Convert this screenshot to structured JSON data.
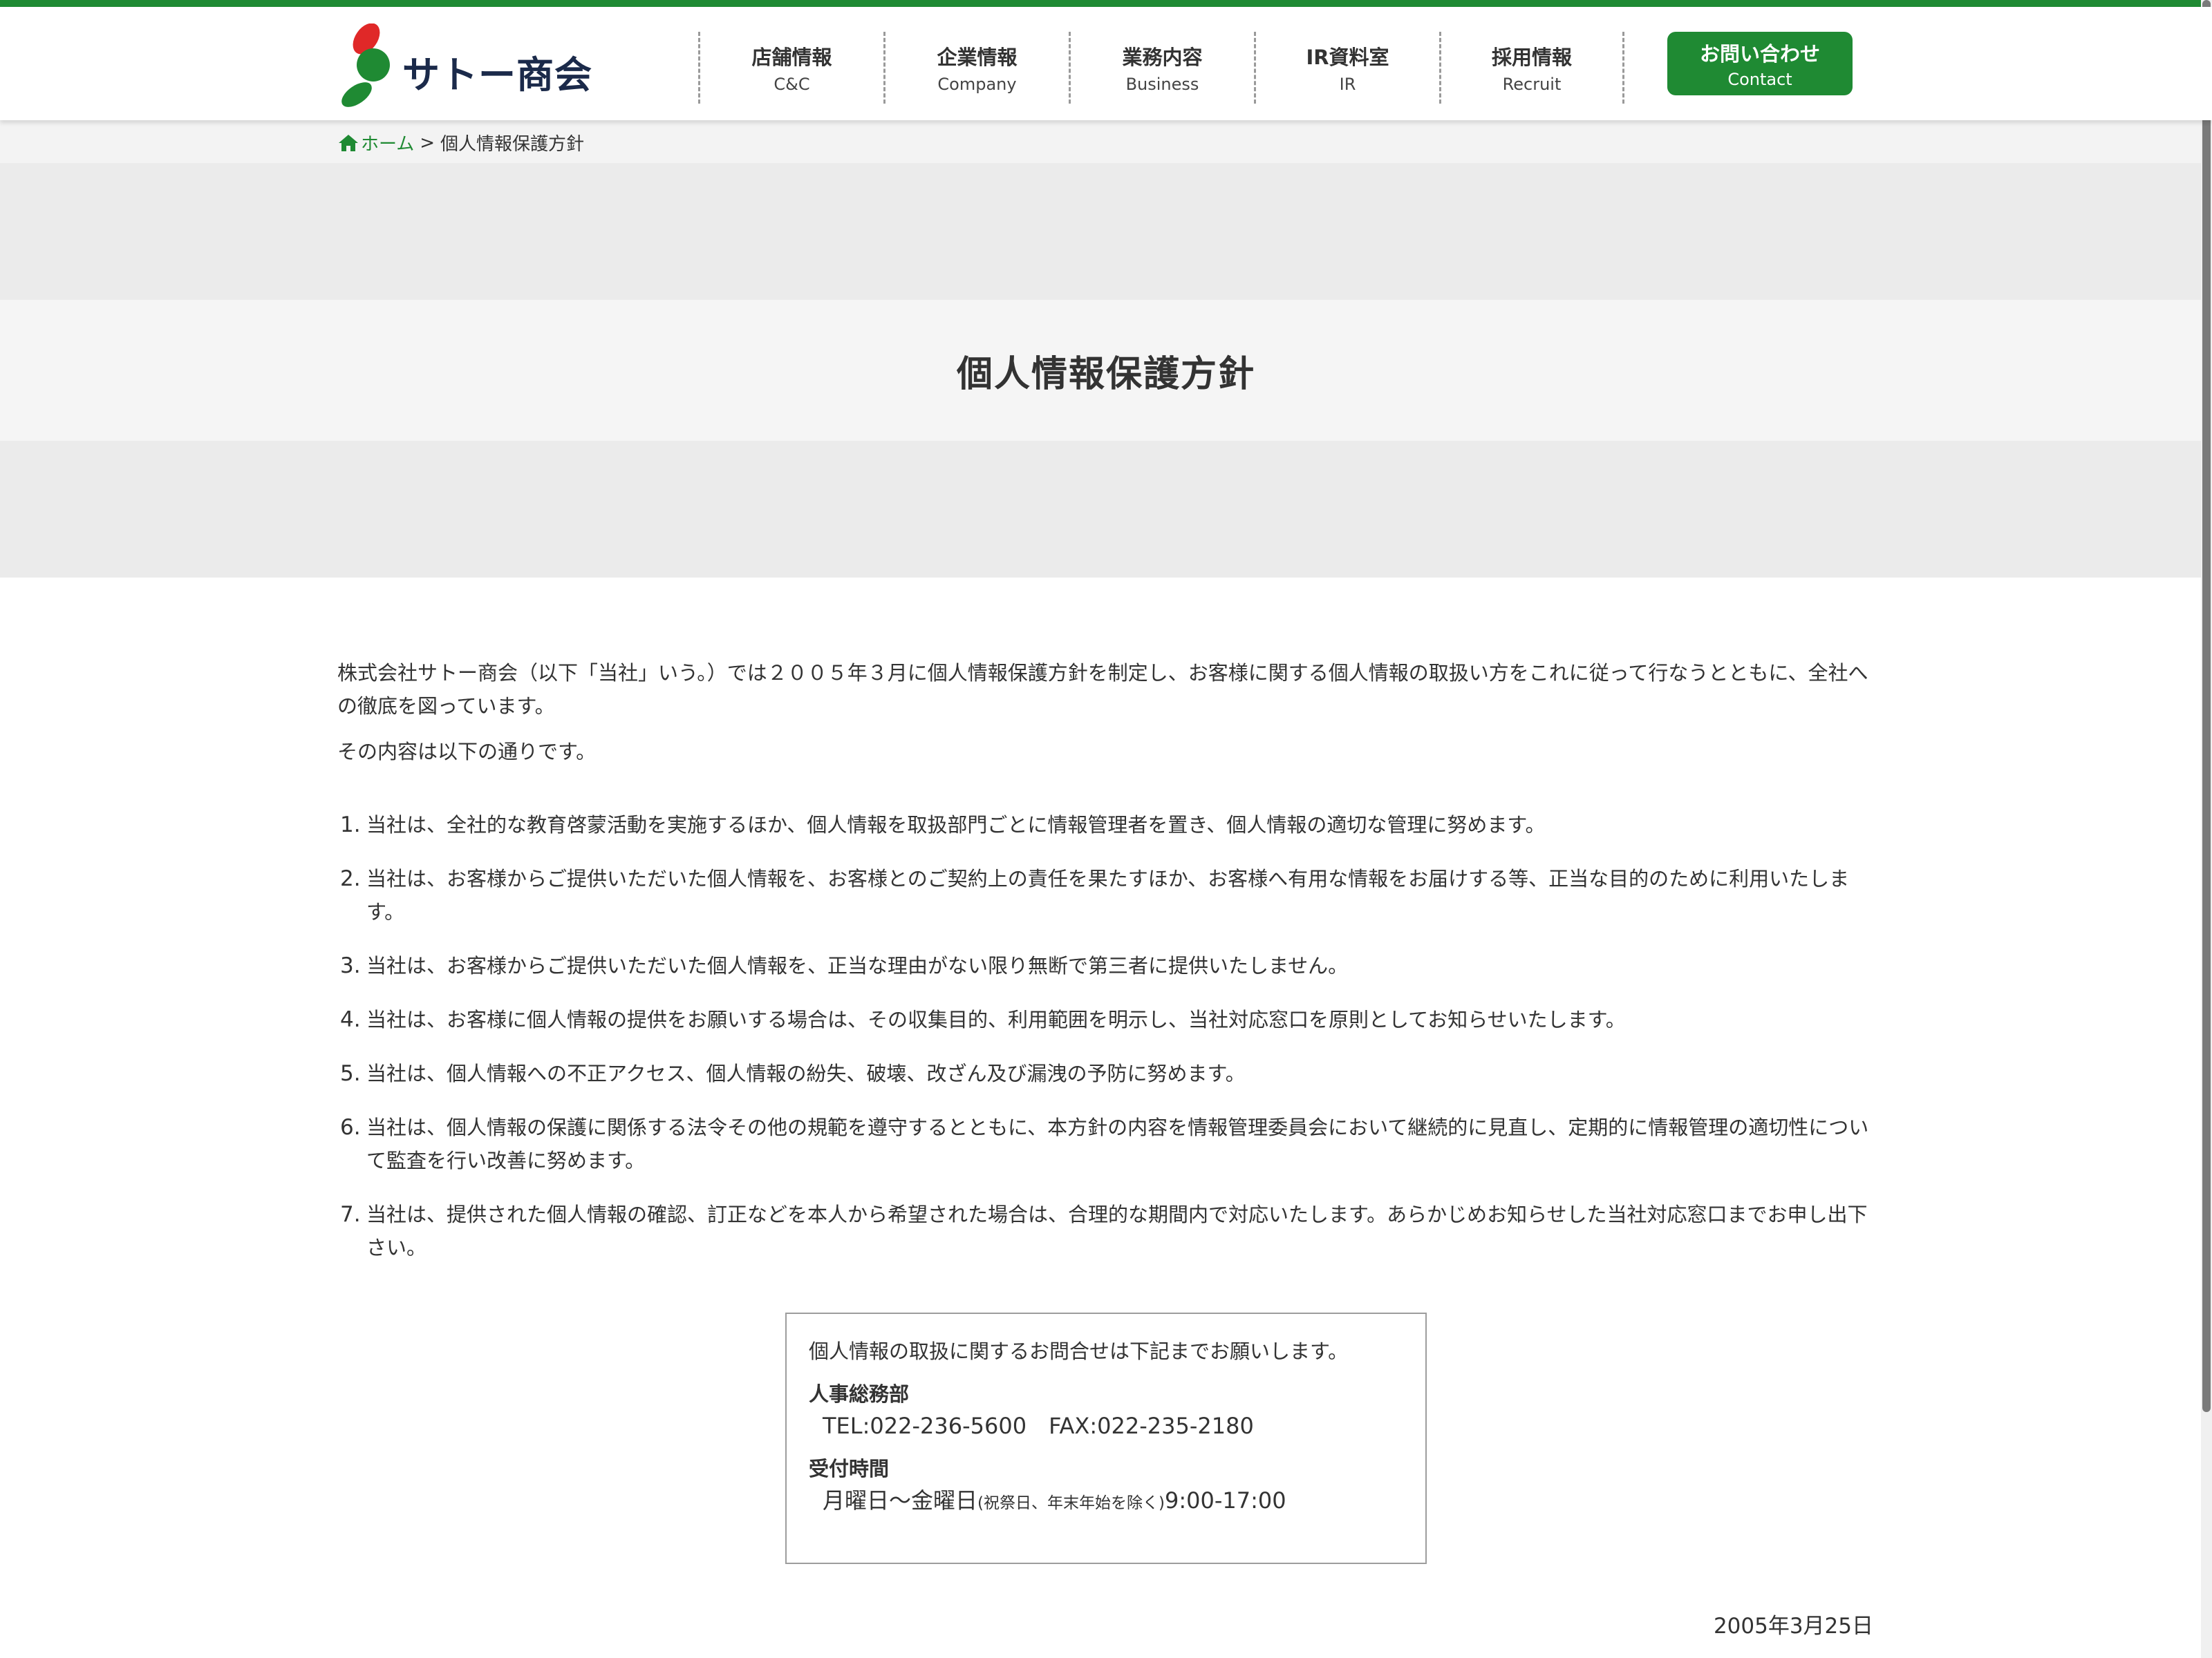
{
  "brand": {
    "name": "サトー商会",
    "colors": {
      "primary": "#1f8a33",
      "logo_red": "#e02828",
      "logo_green": "#1f8a33",
      "navy": "#1b2a4a"
    }
  },
  "nav": {
    "items": [
      {
        "jp": "店舗情報",
        "en": "C&C"
      },
      {
        "jp": "企業情報",
        "en": "Company"
      },
      {
        "jp": "業務内容",
        "en": "Business"
      },
      {
        "jp": "IR資料室",
        "en": "IR"
      },
      {
        "jp": "採用情報",
        "en": "Recruit"
      }
    ],
    "contact": {
      "jp": "お問い合わせ",
      "en": "Contact"
    }
  },
  "breadcrumb": {
    "home": "ホーム",
    "separator": ">",
    "current": "個人情報保護方針",
    "home_icon": "home-icon"
  },
  "page": {
    "title": "個人情報保護方針"
  },
  "content": {
    "intro": "株式会社サトー商会（以下「当社」いう。）では２００５年３月に個人情報保護方針を制定し、お客様に関する個人情報の取扱い方をこれに従って行なうとともに、全社への徹底を図っています。",
    "intro2": "その内容は以下の通りです。",
    "policies": [
      {
        "num": "1.",
        "text": "当社は、全社的な教育啓蒙活動を実施するほか、個人情報を取扱部門ごとに情報管理者を置き、個人情報の適切な管理に努めます。"
      },
      {
        "num": "2.",
        "text": "当社は、お客様からご提供いただいた個人情報を、お客様とのご契約上の責任を果たすほか、お客様へ有用な情報をお届けする等、正当な目的のために利用いたします。"
      },
      {
        "num": "3.",
        "text": "当社は、お客様からご提供いただいた個人情報を、正当な理由がない限り無断で第三者に提供いたしません。"
      },
      {
        "num": "4.",
        "text": "当社は、お客様に個人情報の提供をお願いする場合は、その収集目的、利用範囲を明示し、当社対応窓口を原則としてお知らせいたします。"
      },
      {
        "num": "5.",
        "text": "当社は、個人情報への不正アクセス、個人情報の紛失、破壊、改ざん及び漏洩の予防に努めます。"
      },
      {
        "num": "6.",
        "text": "当社は、個人情報の保護に関係する法令その他の規範を遵守するとともに、本方針の内容を情報管理委員会において継続的に見直し、定期的に情報管理の適切性について監査を行い改善に努めます。"
      },
      {
        "num": "7.",
        "text": "当社は、提供された個人情報の確認、訂正などを本人から希望された場合は、合理的な期間内で対応いたします。あらかじめお知らせした当社対応窓口までお申し出下さい。"
      }
    ]
  },
  "contact_box": {
    "lead": "個人情報の取扱に関するお問合せは下記までお願いします。",
    "dept": "人事総務部",
    "phones": "TEL:022-236-5600　FAX:022-235-2180",
    "hours_label": "受付時間",
    "hours_days": "月曜日～金曜日",
    "hours_note": "(祝祭日、年末年始を除く)",
    "hours_time": "9:00-17:00"
  },
  "date": "2005年3月25日"
}
